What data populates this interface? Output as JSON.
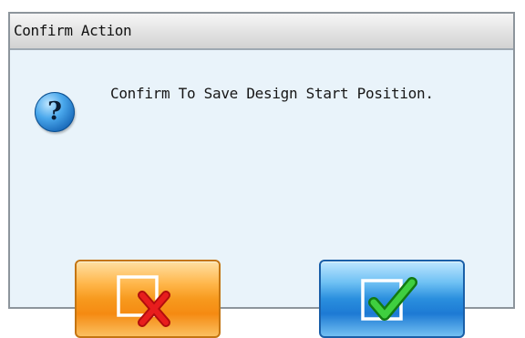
{
  "dialog": {
    "title": "Confirm Action",
    "message": "Confirm To Save Design Start Position.",
    "question_glyph": "?",
    "icon": "question-icon",
    "buttons": {
      "cancel": {
        "icon": "box-with-red-x-icon",
        "color": "#f58a12"
      },
      "confirm": {
        "icon": "box-with-green-check-icon",
        "color": "#2a8fde"
      }
    }
  }
}
